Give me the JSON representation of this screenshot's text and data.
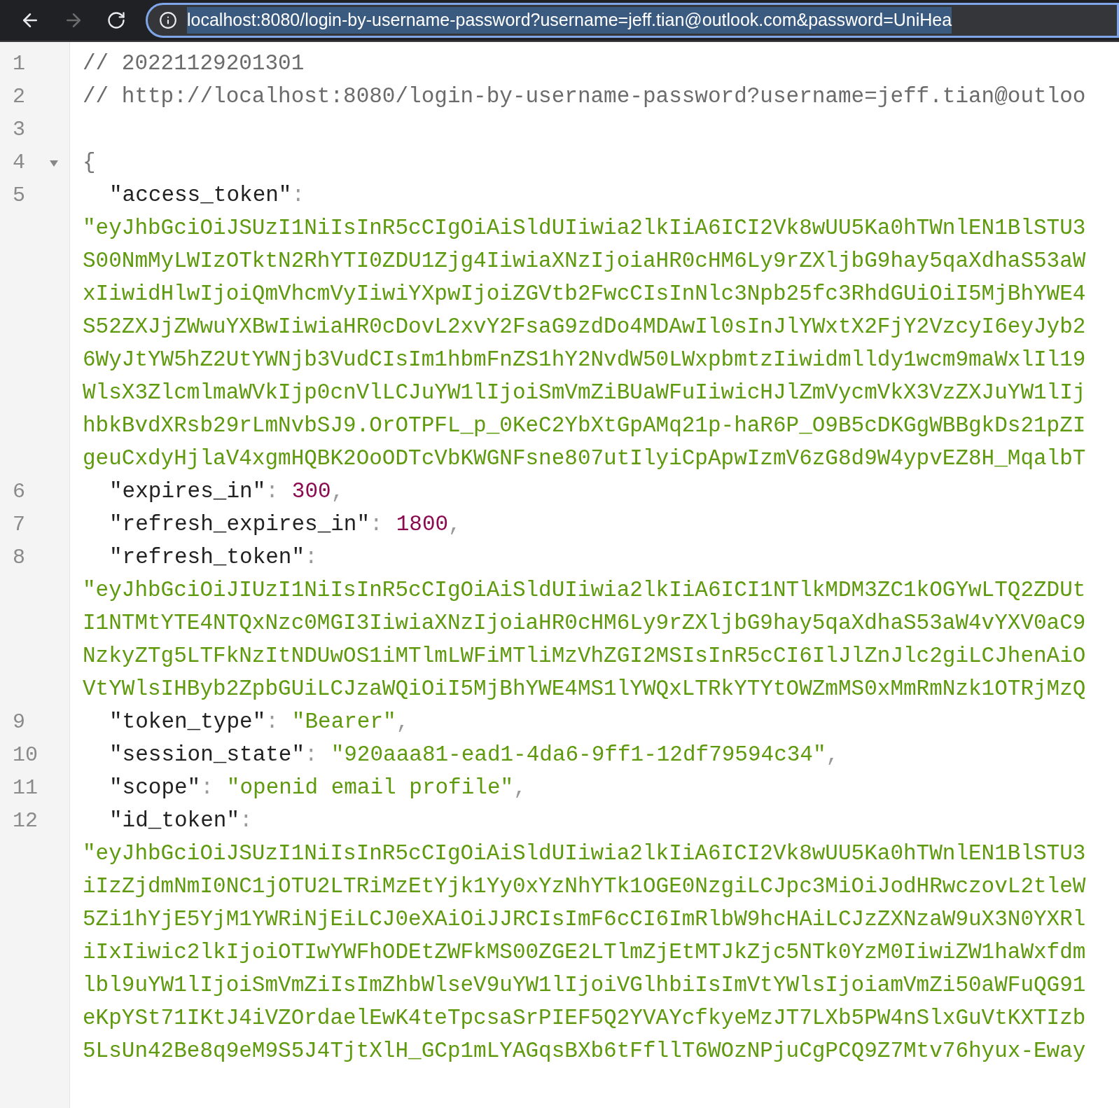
{
  "toolbar": {
    "back": {
      "disabled": false
    },
    "forward": {
      "disabled": true
    },
    "url": "localhost:8080/login-by-username-password?username=jeff.tian@outlook.com&password=UniHea",
    "url_selected": true
  },
  "rows": [
    {
      "number": "1",
      "kind": "comment",
      "text": "// 20221129201301"
    },
    {
      "number": "2",
      "kind": "comment",
      "text": "// http://localhost:8080/login-by-username-password?username=jeff.tian@outloo"
    },
    {
      "number": "3",
      "kind": "blank"
    },
    {
      "number": "4",
      "kind": "brace",
      "text": "{",
      "expanded": true
    },
    {
      "number": "5",
      "kind": "key",
      "key": "\"access_token\"",
      "sep": ":"
    },
    {
      "kind": "string",
      "text": "\"eyJhbGciOiJSUzI1NiIsInR5cCIgOiAiSldUIiwia2lkIiA6ICI2Vk8wUU5Ka0hTWnlEN1BlSTU3"
    },
    {
      "kind": "string",
      "text": "S00NmMyLWIzOTktN2RhYTI0ZDU1Zjg4IiwiaXNzIjoiaHR0cHM6Ly9rZXljbG9hay5qaXdhaS53aW"
    },
    {
      "kind": "string",
      "text": "xIiwidHlwIjoiQmVhcmVyIiwiYXpwIjoiZGVtb2FwcCIsInNlc3Npb25fc3RhdGUiOiI5MjBhYWE4"
    },
    {
      "kind": "string",
      "text": "S52ZXJjZWwuYXBwIiwiaHR0cDovL2xvY2FsaG9zdDo4MDAwIl0sInJlYWxtX2FjY2VzcyI6eyJyb2"
    },
    {
      "kind": "string",
      "text": "6WyJtYW5hZ2UtYWNjb3VudCIsIm1hbmFnZS1hY2NvdW50LWxpbmtzIiwidmlldy1wcm9maWxlIl19"
    },
    {
      "kind": "string",
      "text": "WlsX3ZlcmlmaWVkIjp0cnVlLCJuYW1lIjoiSmVmZiBUaWFuIiwicHJlZmVycmVkX3VzZXJuYW1lIj"
    },
    {
      "kind": "string",
      "text": "hbkBvdXRsb29rLmNvbSJ9.OrOTPFL_p_0KeC2YbXtGpAMq21p-haR6P_O9B5cDKGgWBBgkDs21pZI"
    },
    {
      "kind": "string",
      "text": "geuCxdyHjlaV4xgmHQBK2OoODTcVbKWGNFsne807utIlyiCpApwIzmV6zG8d9W4ypvEZ8H_MqalbT"
    },
    {
      "number": "6",
      "kind": "number",
      "key": "\"expires_in\"",
      "sep": ":",
      "value": "300",
      "comma": ","
    },
    {
      "number": "7",
      "kind": "number",
      "key": "\"refresh_expires_in\"",
      "sep": ":",
      "value": "1800",
      "comma": ","
    },
    {
      "number": "8",
      "kind": "key",
      "key": "\"refresh_token\"",
      "sep": ":"
    },
    {
      "kind": "string",
      "text": "\"eyJhbGciOiJIUzI1NiIsInR5cCIgOiAiSldUIiwia2lkIiA6ICI1NTlkMDM3ZC1kOGYwLTQ2ZDUt"
    },
    {
      "kind": "string",
      "text": "I1NTMtYTE4NTQxNzc0MGI3IiwiaXNzIjoiaHR0cHM6Ly9rZXljbG9hay5qaXdhaS53aW4vYXV0aC9"
    },
    {
      "kind": "string",
      "text": "NzkyZTg5LTFkNzItNDUwOS1iMTlmLWFiMTliMzVhZGI2MSIsInR5cCI6IlJlZnJlc2giLCJhenAiO"
    },
    {
      "kind": "string",
      "text": "VtYWlsIHByb2ZpbGUiLCJzaWQiOiI5MjBhYWE4MS1lYWQxLTRkYTYtOWZmMS0xMmRmNzk1OTRjMzQ"
    },
    {
      "number": "9",
      "kind": "text",
      "key": "\"token_type\"",
      "sep": ":",
      "value": "\"Bearer\"",
      "comma": ","
    },
    {
      "number": "10",
      "kind": "text",
      "key": "\"session_state\"",
      "sep": ":",
      "value": "\"920aaa81-ead1-4da6-9ff1-12df79594c34\"",
      "comma": ","
    },
    {
      "number": "11",
      "kind": "text",
      "key": "\"scope\"",
      "sep": ":",
      "value": "\"openid email profile\"",
      "comma": ","
    },
    {
      "number": "12",
      "kind": "key",
      "key": "\"id_token\"",
      "sep": ":"
    },
    {
      "kind": "string",
      "text": "\"eyJhbGciOiJSUzI1NiIsInR5cCIgOiAiSldUIiwia2lkIiA6ICI2Vk8wUU5Ka0hTWnlEN1BlSTU3"
    },
    {
      "kind": "string",
      "text": "iIzZjdmNmI0NC1jOTU2LTRiMzEtYjk1Yy0xYzNhYTk1OGE0NzgiLCJpc3MiOiJodHRwczovL2tleW"
    },
    {
      "kind": "string",
      "text": "5Zi1hYjE5YjM1YWRiNjEiLCJ0eXAiOiJJRCIsImF6cCI6ImRlbW9hcHAiLCJzZXNzaW9uX3N0YXRl"
    },
    {
      "kind": "string",
      "text": "iIxIiwic2lkIjoiOTIwYWFhODEtZWFkMS00ZGE2LTlmZjEtMTJkZjc5NTk0YzM0IiwiZW1haWxfdm"
    },
    {
      "kind": "string",
      "text": "lbl9uYW1lIjoiSmVmZiIsImZhbWlseV9uYW1lIjoiVGlhbiIsImVtYWlsIjoiamVmZi50aWFuQG91"
    },
    {
      "kind": "string",
      "text": "eKpYSt71IKtJ4iVZOrdaelEwK4teTpcsaSrPIEF5Q2YVAYcfkyeMzJT7LXb5PW4nSlxGuVtKXTIzb"
    },
    {
      "kind": "string",
      "text": "5LsUn42Be8q9eM9S5J4TjtXlH_GCp1mLYAGqsBXb6tFfllT6WOzNPjuCgPCQ9Z7Mtv76hyux-Eway"
    }
  ]
}
